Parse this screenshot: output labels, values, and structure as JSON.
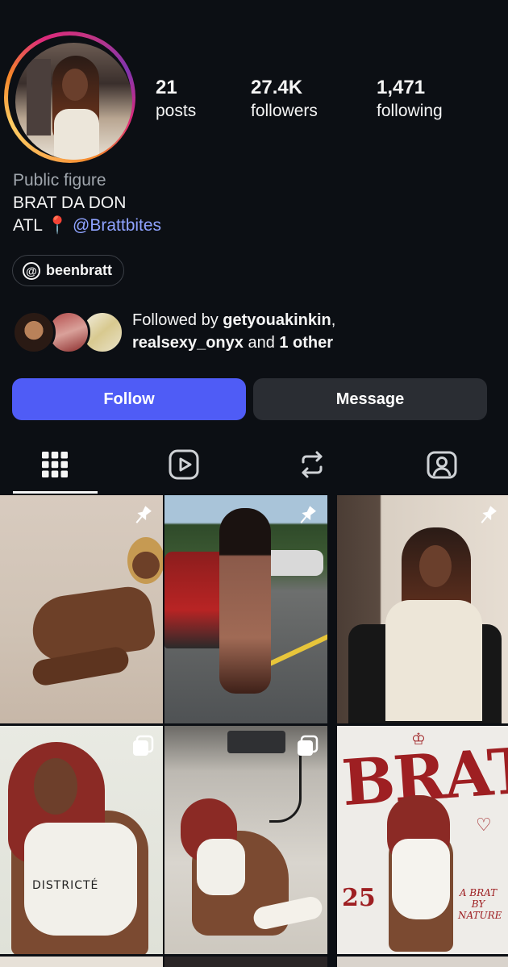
{
  "profile": {
    "stats": [
      {
        "value": "21",
        "label": "posts"
      },
      {
        "value": "27.4K",
        "label": "followers"
      },
      {
        "value": "1,471",
        "label": "following"
      }
    ],
    "category": "Public figure",
    "name": "BRAT DA DON",
    "location_text": "ATL",
    "location_emoji": "📍",
    "link_handle": "@Brattbites",
    "threads_handle": "beenbratt"
  },
  "followed_by": {
    "prefix": "Followed by ",
    "user1": "getyouakinkin",
    "comma": ",",
    "user2": "realsexy_onyx",
    "and": " and ",
    "others": "1 other"
  },
  "actions": {
    "follow_label": "Follow",
    "message_label": "Message"
  },
  "tabs": [
    {
      "icon": "grid-icon",
      "active": true
    },
    {
      "icon": "reels-icon",
      "active": false
    },
    {
      "icon": "reposts-icon",
      "active": false
    },
    {
      "icon": "tagged-icon",
      "active": false
    }
  ],
  "posts": [
    {
      "badge": "pin-icon"
    },
    {
      "badge": "pin-icon"
    },
    {
      "badge": "pin-icon"
    },
    {
      "badge": "carousel-icon",
      "overlay_text": "DISTRICTÉ"
    },
    {
      "badge": "carousel-icon"
    },
    {
      "badge": null,
      "overlay_text": "BRAT",
      "number_text": "25",
      "tagline": "A BRAT BY NATURE"
    }
  ],
  "colors": {
    "background": "#0c0f14",
    "follow_button": "#4f5cf6",
    "message_button": "#2a2d33",
    "link": "#8fa3ff"
  }
}
